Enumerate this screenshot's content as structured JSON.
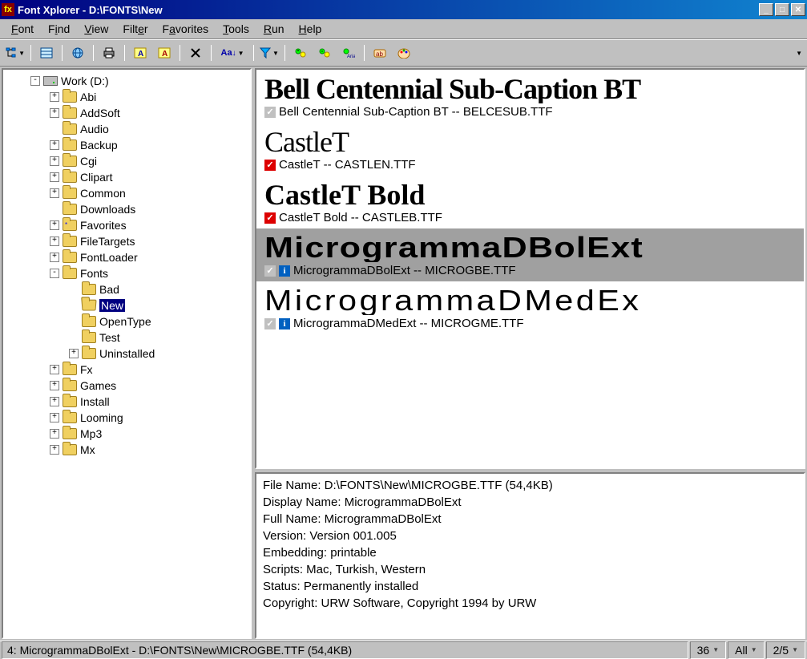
{
  "window": {
    "title": "Font Xplorer - D:\\FONTS\\New"
  },
  "menu": {
    "items": [
      "Font",
      "Find",
      "View",
      "Filter",
      "Favorites",
      "Tools",
      "Run",
      "Help"
    ],
    "underline": [
      0,
      1,
      0,
      4,
      1,
      0,
      0,
      0
    ]
  },
  "tree": {
    "root": "Work (D:)",
    "nodes": [
      {
        "label": "Abi",
        "exp": "+",
        "depth": 2
      },
      {
        "label": "AddSoft",
        "exp": "+",
        "depth": 2
      },
      {
        "label": "Audio",
        "exp": "",
        "depth": 2
      },
      {
        "label": "Backup",
        "exp": "+",
        "depth": 2
      },
      {
        "label": "Cgi",
        "exp": "+",
        "depth": 2
      },
      {
        "label": "Clipart",
        "exp": "+",
        "depth": 2
      },
      {
        "label": "Common",
        "exp": "+",
        "depth": 2
      },
      {
        "label": "Downloads",
        "exp": "",
        "depth": 2
      },
      {
        "label": "Favorites",
        "exp": "+",
        "depth": 2,
        "star": true
      },
      {
        "label": "FileTargets",
        "exp": "+",
        "depth": 2
      },
      {
        "label": "FontLoader",
        "exp": "+",
        "depth": 2
      },
      {
        "label": "Fonts",
        "exp": "-",
        "depth": 2
      },
      {
        "label": "Bad",
        "exp": "",
        "depth": 3
      },
      {
        "label": "New",
        "exp": "",
        "depth": 3,
        "selected": true,
        "open": true
      },
      {
        "label": "OpenType",
        "exp": "",
        "depth": 3
      },
      {
        "label": "Test",
        "exp": "",
        "depth": 3
      },
      {
        "label": "Uninstalled",
        "exp": "+",
        "depth": 3
      },
      {
        "label": "Fx",
        "exp": "+",
        "depth": 2
      },
      {
        "label": "Games",
        "exp": "+",
        "depth": 2
      },
      {
        "label": "Install",
        "exp": "+",
        "depth": 2
      },
      {
        "label": "Looming",
        "exp": "+",
        "depth": 2
      },
      {
        "label": "Mp3",
        "exp": "+",
        "depth": 2
      },
      {
        "label": "Mx",
        "exp": "+",
        "depth": 2
      }
    ]
  },
  "fonts": [
    {
      "name": "Bell Centennial Sub-Caption BT",
      "file": "BELCESUB.TTF",
      "check": "grey",
      "class": "f-bell",
      "info": false
    },
    {
      "name": "CastleT",
      "file": "CASTLEN.TTF",
      "check": "red",
      "class": "f-castlet",
      "info": false
    },
    {
      "name": "CastleT Bold",
      "file": "CASTLEB.TTF",
      "check": "red",
      "class": "f-castletb",
      "info": false
    },
    {
      "name": "MicrogrammaDBolExt",
      "file": "MICROGBE.TTF",
      "check": "grey",
      "class": "f-microb",
      "info": true,
      "selected": true
    },
    {
      "name": "MicrogrammaDMedExt",
      "file": "MICROGME.TTF",
      "check": "grey",
      "class": "f-microm",
      "info": true,
      "preview": "MicrogrammaDMedEx"
    }
  ],
  "details": {
    "lines": [
      "File Name: D:\\FONTS\\New\\MICROGBE.TTF (54,4KB)",
      "Display Name: MicrogrammaDBolExt",
      "Full Name: MicrogrammaDBolExt",
      "Version: Version 001.005",
      "Embedding: printable",
      "Scripts: Mac, Turkish, Western",
      "Status: Permanently installed",
      "Copyright: URW Software, Copyright 1994 by URW"
    ]
  },
  "status": {
    "main": "4: MicrogrammaDBolExt - D:\\FONTS\\New\\MICROGBE.TTF (54,4KB)",
    "size": "36",
    "filter": "All",
    "page": "2/5"
  }
}
